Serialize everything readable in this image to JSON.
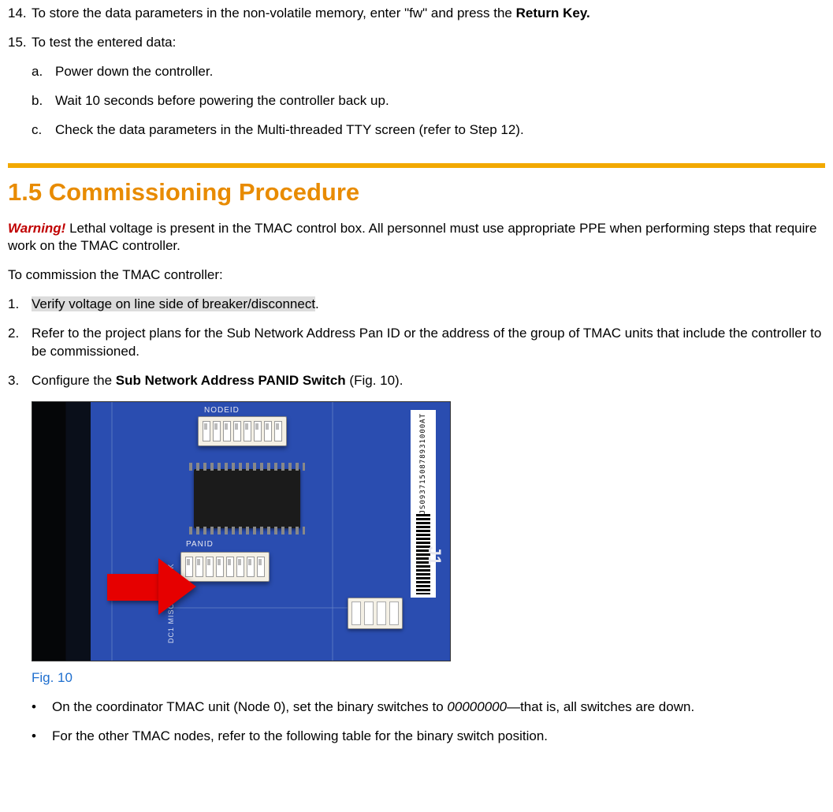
{
  "steps_top": {
    "n14": "14.",
    "t14a": "To store the data parameters in the non-volatile memory, enter \"fw\" and press the ",
    "t14b": "Return Key.",
    "n15": "15.",
    "t15": "To test the entered data:",
    "na": "a.",
    "ta": "Power down the controller.",
    "nb": "b.",
    "tb": "Wait 10 seconds before powering the controller back up.",
    "nc": "c.",
    "tc": "Check the data parameters in the Multi-threaded TTY screen (refer to Step 12)."
  },
  "heading": "1.5  Commissioning Procedure",
  "warning": {
    "label": "Warning!",
    "text": " Lethal voltage is present in the TMAC control box. All personnel must use appropriate PPE when performing steps that require work on the TMAC controller."
  },
  "intro": "To commission the TMAC controller:",
  "steps_main": {
    "n1": "1.",
    "t1_hl": "Verify voltage on line side of breaker/disconnect",
    "t1_tail": ".",
    "n2": "2.",
    "t2": "Refer to the project plans for the Sub Network Address Pan ID or the address of the group of TMAC units that include the controller to be commissioned.",
    "n3": "3.",
    "t3a": "Configure the ",
    "t3b": "Sub Network Address PANID Switch",
    "t3c": " (Fig. 10)."
  },
  "board": {
    "nodeid": "NODEID",
    "panid": "PANID",
    "barcode": "JS0937150878931000AT",
    "j1": "J1",
    "silks": "DC1  MISO  MISI  CLK"
  },
  "fig_caption": "Fig. 10",
  "bullets": {
    "b1a": "On the coordinator TMAC unit (Node 0), set the binary switches to ",
    "b1i": "00000000",
    "b1b": "—that is, all switches are down.",
    "b2": "For the other TMAC nodes, refer to the following table for the  binary switch position."
  }
}
